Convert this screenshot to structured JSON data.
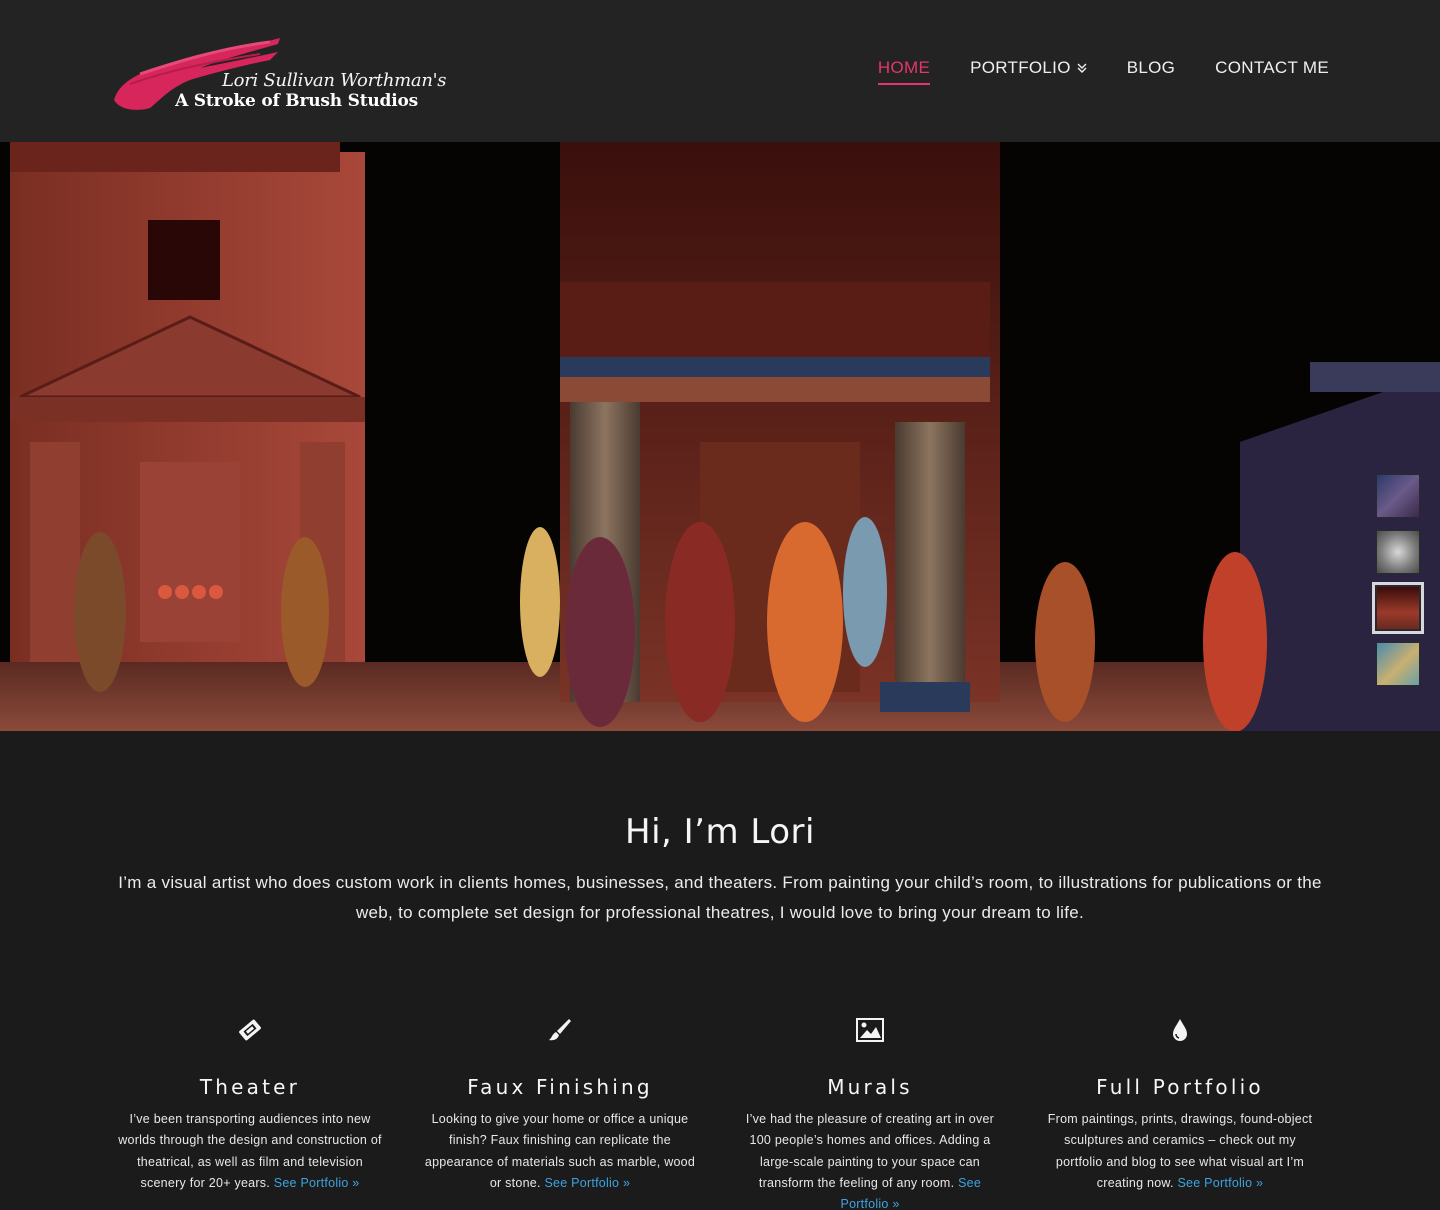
{
  "header": {
    "logo": {
      "line1": "Lori Sullivan Worthman's",
      "line2": "A Stroke of Brush Studios",
      "brush_color": "#d6265b"
    },
    "nav": [
      {
        "label": "HOME",
        "active": true
      },
      {
        "label": "PORTFOLIO",
        "has_dropdown": true,
        "icon": "double-chevron-down-icon"
      },
      {
        "label": "BLOG"
      },
      {
        "label": "CONTACT ME"
      }
    ],
    "accent_color": "#e6356b"
  },
  "slider": {
    "thumbnails": [
      {
        "icon": "thumbnail-stage-blue",
        "active": false
      },
      {
        "icon": "thumbnail-ornament",
        "active": false
      },
      {
        "icon": "thumbnail-stage-red",
        "active": true
      },
      {
        "icon": "thumbnail-mural",
        "active": false
      }
    ]
  },
  "intro": {
    "heading": "Hi, I’m Lori",
    "text": "I’m a visual artist who does custom work in clients homes, businesses, and theaters. From painting your child’s room, to illustrations for publications or the web, to complete set design for professional theatres, I would love to bring your dream to life."
  },
  "features": [
    {
      "icon": "ticket-icon",
      "title": "Theater",
      "text": "I’ve been transporting audiences into new worlds through the design and construction of theatrical, as well as film and television scenery for 20+ years.",
      "link": "See Portfolio »"
    },
    {
      "icon": "paint-brush-icon",
      "title": "Faux Finishing",
      "text": "Looking to give your home or office a unique finish? Faux finishing can replicate the appearance of materials such as marble, wood or stone.",
      "link": "See Portfolio »"
    },
    {
      "icon": "picture-icon",
      "title": "Murals",
      "text": "I’ve had the pleasure of creating art in over 100 people’s homes and offices. Adding a large-scale painting to your space can transform the feeling of any room.",
      "link": "See Portfolio »"
    },
    {
      "icon": "tint-drop-icon",
      "title": "Full Portfolio",
      "text": "From paintings, prints, drawings, found-object sculptures and ceramics – check out my portfolio and blog to see what visual art I’m creating now.",
      "link": "See Portfolio »"
    }
  ],
  "link_color": "#3ea3e0"
}
